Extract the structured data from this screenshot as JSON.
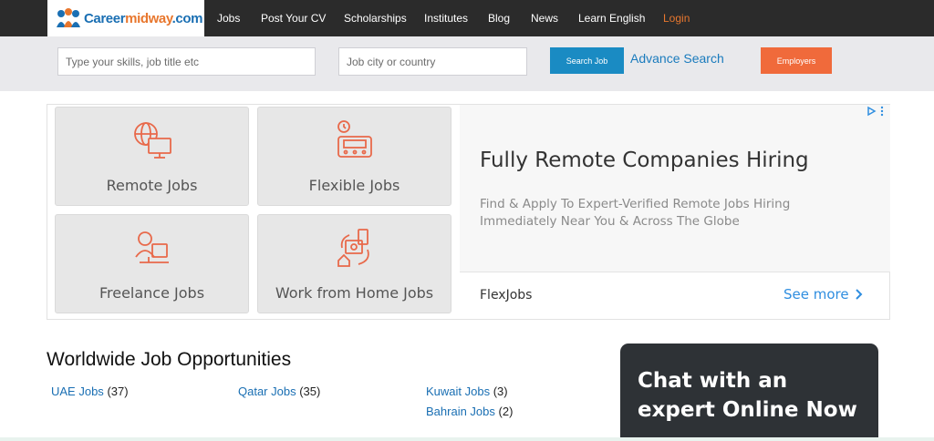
{
  "header": {
    "logo": {
      "part1": "Career",
      "part2": "midway",
      "part3": ".com"
    },
    "nav": [
      "Jobs",
      "Post Your CV",
      "Scholarships",
      "Institutes",
      "Blog",
      "News",
      "Learn English"
    ],
    "login": "Login"
  },
  "search": {
    "skills_placeholder": "Type your skills, job title etc",
    "location_placeholder": "Job city or country",
    "search_button": "Search Job",
    "advance_link": "Advance Search",
    "employers_button": "Employers"
  },
  "ad": {
    "tiles": [
      "Remote Jobs",
      "Flexible Jobs",
      "Freelance Jobs",
      "Work from Home Jobs"
    ],
    "headline": "Fully Remote Companies Hiring",
    "body": "Find & Apply To Expert-Verified Remote Jobs Hiring Immediately Near You & Across The Globe",
    "brand": "FlexJobs",
    "cta": "See more"
  },
  "worldwide": {
    "title": "Worldwide Job Opportunities",
    "links": [
      {
        "label": "UAE Jobs",
        "count": "(37)"
      },
      {
        "label": "Qatar Jobs",
        "count": "(35)"
      },
      {
        "label": "Kuwait Jobs",
        "count": "(3)"
      },
      {
        "label": "Bahrain Jobs",
        "count": "(2)"
      }
    ]
  },
  "chat": {
    "line1": "Chat with an",
    "line2": "expert Online Now"
  },
  "colors": {
    "brand_blue": "#1a6fb3",
    "brand_orange": "#e8772e",
    "nav_bg": "#2b2b2b",
    "search_btn": "#1a8bc3",
    "employers_btn": "#f06a3b",
    "chat_bg": "#2e3236"
  }
}
